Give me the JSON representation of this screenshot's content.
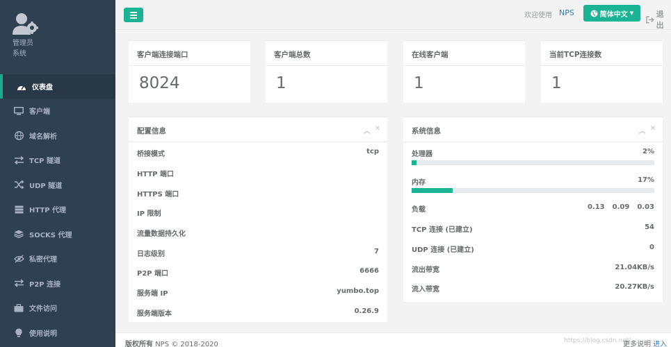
{
  "sidebar": {
    "role_line1": "管理员",
    "role_line2": "系统",
    "items": [
      {
        "label": "仪表盘",
        "icon": "dashboard-icon"
      },
      {
        "label": "客户端",
        "icon": "desktop-icon"
      },
      {
        "label": "域名解析",
        "icon": "globe-icon"
      },
      {
        "label": "TCP 隧道",
        "icon": "exchange-icon"
      },
      {
        "label": "UDP 隧道",
        "icon": "random-icon"
      },
      {
        "label": "HTTP 代理",
        "icon": "server-icon"
      },
      {
        "label": "SOCKS 代理",
        "icon": "layers-icon"
      },
      {
        "label": "私密代理",
        "icon": "eye-slash-icon"
      },
      {
        "label": "P2P 连接",
        "icon": "arrows-icon"
      },
      {
        "label": "文件访问",
        "icon": "briefcase-icon"
      },
      {
        "label": "使用说明",
        "icon": "lightbulb-icon"
      }
    ]
  },
  "topbar": {
    "welcome": "欢迎使用",
    "app_link": "NPS",
    "language": "简体中文",
    "logout": "退出"
  },
  "stats": [
    {
      "title": "客户端连接端口",
      "value": "8024"
    },
    {
      "title": "客户端总数",
      "value": "1"
    },
    {
      "title": "在线客户端",
      "value": "1"
    },
    {
      "title": "当前TCP连接数",
      "value": "1"
    }
  ],
  "config": {
    "title": "配置信息",
    "rows": [
      {
        "k": "桥接模式",
        "v": "tcp"
      },
      {
        "k": "HTTP 端口",
        "v": ""
      },
      {
        "k": "HTTPS 端口",
        "v": ""
      },
      {
        "k": "IP 限制",
        "v": ""
      },
      {
        "k": "流量数据持久化",
        "v": ""
      },
      {
        "k": "日志级别",
        "v": "7"
      },
      {
        "k": "P2P 端口",
        "v": "6666"
      },
      {
        "k": "服务端 IP",
        "v": "yumbo.top"
      },
      {
        "k": "服务端版本",
        "v": "0.26.9"
      }
    ]
  },
  "system": {
    "title": "系统信息",
    "cpu_label": "处理器",
    "cpu_value": "2%",
    "cpu_percent": 2,
    "mem_label": "内存",
    "mem_value": "17%",
    "mem_percent": 17,
    "load_label": "负载",
    "load": [
      "0.13",
      "0.09",
      "0.03"
    ],
    "rows": [
      {
        "k": "TCP 连接 (已建立)",
        "v": "54"
      },
      {
        "k": "UDP 连接 (已建立)",
        "v": "0"
      },
      {
        "k": "流出带宽",
        "v": "21.04KB/s"
      },
      {
        "k": "流入带宽",
        "v": "20.27KB/s"
      }
    ]
  },
  "footer": {
    "copyright_bold": "版权所有",
    "copyright_rest": "NPS © 2018-2020",
    "watermark": "https://blog.csdn.net/...",
    "more": "更多说明",
    "enter": "进入"
  },
  "colors": {
    "sidebar_bg": "#2f4050",
    "accent": "#1ab394",
    "link": "#337ab7"
  }
}
